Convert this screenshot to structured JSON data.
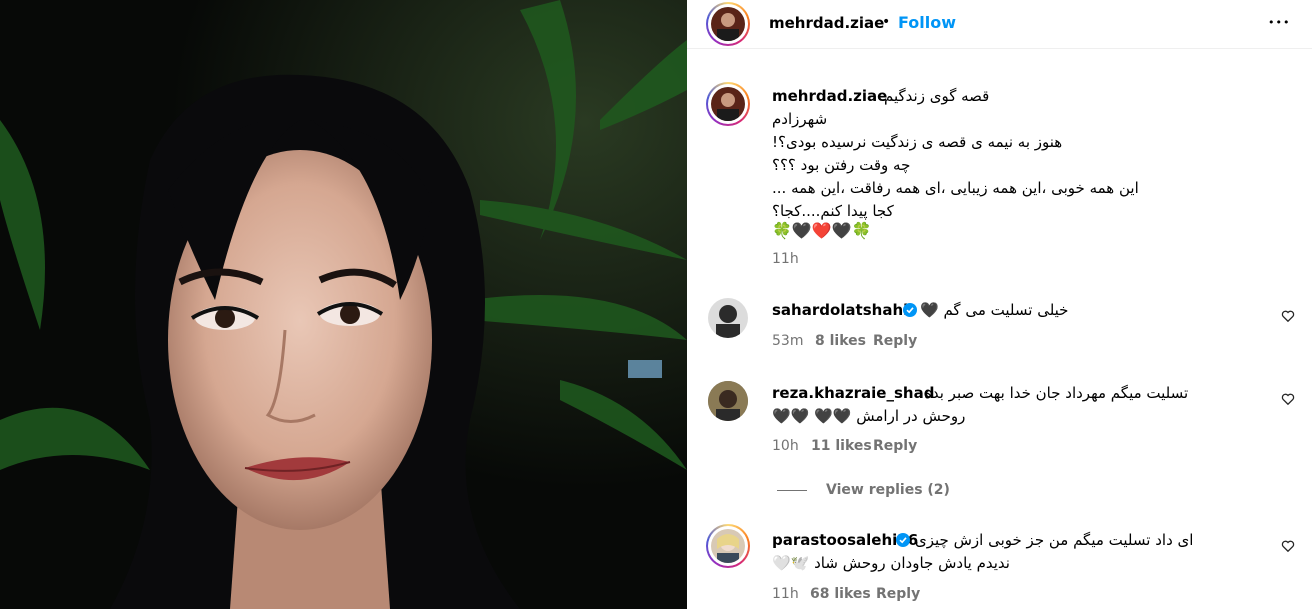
{
  "post": {
    "username": "mehrdad.ziae",
    "follow_label": "Follow",
    "separator": "•",
    "more_label": "•••"
  },
  "caption": {
    "username": "mehrdad.ziae",
    "lines": [
      "قصه گوی زندگیم",
      "شهرزادم",
      "هنوز به نیمه ی قصه ی زندگیت نرسیده بودی؟!",
      "چه وقت رفتن بود ؟؟؟",
      "این همه خوبی ،این همه زیبایی ،ای همه رفاقت ،این همه ...",
      "کجا پیدا کنم....کجا؟",
      "🍀🖤❤️🖤🍀"
    ],
    "time": "11h"
  },
  "comments": [
    {
      "username": "sahardolatshahi",
      "verified": true,
      "text_lines": [
        "خیلی تسلیت می گم 🖤"
      ],
      "time": "53m",
      "likes": "8 likes",
      "reply_label": "Reply"
    },
    {
      "username": "reza.khazraie_shad",
      "verified": false,
      "text_lines": [
        "تسلیت میگم مهرداد جان خدا بهت صبر بده",
        "روحش در ارامش 🖤🖤 🖤🖤"
      ],
      "time": "10h",
      "likes": "11 likes",
      "reply_label": "Reply",
      "view_replies": "View replies (2)"
    },
    {
      "username": "parastoosalehi56",
      "verified": true,
      "text_lines": [
        "ای داد تسلیت میگم من جز خوبی ازش چیزی",
        "ندیدم یادش جاودان روحش شاد 🕊️🤍"
      ],
      "time": "11h",
      "likes": "68 likes",
      "reply_label": "Reply"
    }
  ],
  "colors": {
    "accent": "#0095f6",
    "muted": "#737373",
    "verified": "#0095f6"
  }
}
